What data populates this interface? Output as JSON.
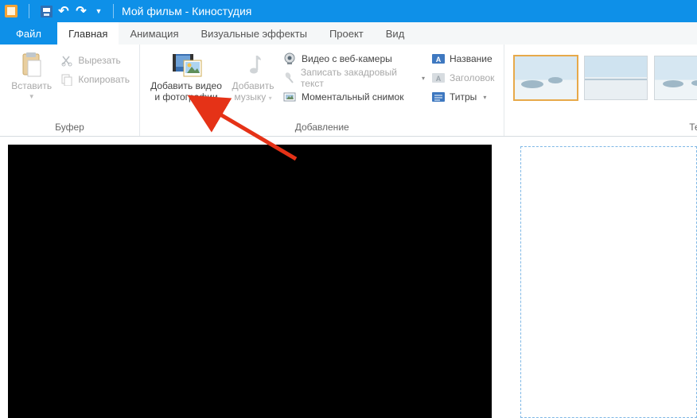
{
  "title": "Мой фильм - Киностудия",
  "tabs": {
    "file": "Файл",
    "home": "Главная",
    "animation": "Анимация",
    "effects": "Визуальные эффекты",
    "project": "Проект",
    "view": "Вид"
  },
  "groups": {
    "clipboard": {
      "label": "Буфер",
      "paste": "Вставить",
      "cut": "Вырезать",
      "copy": "Копировать"
    },
    "add": {
      "label": "Добавление",
      "add_media_l1": "Добавить видео",
      "add_media_l2": "и фотографии",
      "add_music_l1": "Добавить",
      "add_music_l2": "музыку",
      "webcam": "Видео с веб-камеры",
      "narration": "Записать закадровый текст",
      "snapshot": "Моментальный снимок",
      "title": "Название",
      "heading": "Заголовок",
      "credits": "Титры"
    },
    "themes": {
      "label": "Темы а"
    }
  }
}
